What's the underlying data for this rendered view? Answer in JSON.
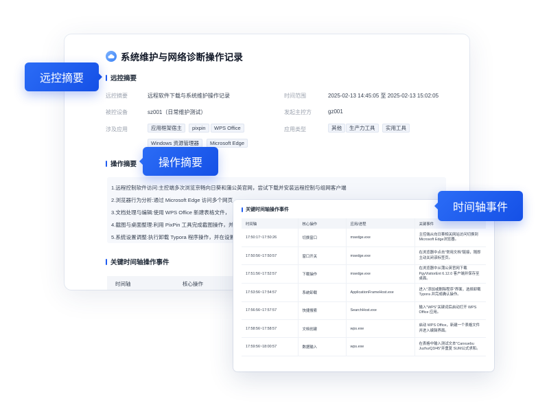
{
  "report": {
    "title": "系统维护与网络诊断操作记录",
    "remote_section": "远控摘要",
    "fields": {
      "summary_label": "远控摘要",
      "summary_value": "远程软件下载与系统维护操作记录",
      "time_label": "时间范围",
      "time_value": "2025-02-13 14:45:05 至 2025-02-13 15:02:05",
      "device_label": "被控设备",
      "device_value": "sz001（日常维护测试）",
      "initiator_label": "发起主控方",
      "initiator_value": "gz001",
      "apps_label": "涉及应用",
      "app_type_label": "应用类型"
    },
    "apps": [
      "应用框架宿主",
      "pixpin",
      "WPS Office",
      "Windows 资源管理器",
      "Microsoft Edge"
    ],
    "app_types": [
      "其他",
      "生产力工具",
      "实用工具"
    ],
    "ops_section": "操作摘要",
    "ops": [
      "1.远程控制软件访问:主控端多次浏览京畅向日葵和蒲公英官网，尝试下载并安装远程控制与组网客户端",
      "2.浏览器行为分析:通过 Microsoft Edge 访问多个网页",
      "3.文档处理与编辑:使用 WPS Office 新建表格文件，",
      "4.截图与桌面整理:利用 PixPin 工具完成截图操作，并",
      "5.系统设置调整:执行卸载 Typora 程序操作，并在设置"
    ],
    "timeline_section": "关键时间轴操作事件",
    "mini_headers": [
      "时间轴",
      "核心操作"
    ]
  },
  "callouts": {
    "remote": "远控摘要",
    "ops": "操作摘要",
    "timeline": "时间轴事件"
  },
  "timeline_panel": {
    "title": "关键时间轴操作事件",
    "headers": [
      "时间轴",
      "核心操作",
      "应用/进程",
      "关键事件"
    ],
    "rows": [
      {
        "time": "17:50:17~17:50:26",
        "op": "切换窗口",
        "proc": "msedge.exe",
        "desc": "主控端从向日葵相关网站访问切换到 Microsoft Edge浏览器。"
      },
      {
        "time": "17:50:56~17:50:57",
        "op": "窗口开关",
        "proc": "msedge.exe",
        "desc": "在浏览器中点击\"常用文档\"链接，随即主动关闭该标签页。"
      },
      {
        "time": "17:51:56~17:52:57",
        "op": "下载操作",
        "proc": "msedge.exe",
        "desc": "在浏览器中从蒲公英官网下载 PgyVisitorEnt 6.12.0 客户端并保存至桌面。"
      },
      {
        "time": "17:53:56~17:54:57",
        "op": "系统卸载",
        "proc": "ApplicationFrameHost.exe",
        "desc": "进入\"添加或删除程序\"界面，选择卸载 Typora 并完成确认操作。"
      },
      {
        "time": "17:56:56~17:57:57",
        "op": "快捷搜索",
        "proc": "SearchHost.exe",
        "desc": "输入\"WPS\"关键词后启动打开 WPS Office 应用。"
      },
      {
        "time": "17:58:56~17:58:57",
        "op": "文档创建",
        "proc": "wps.exe",
        "desc": "启动 WPS Office，新建一个表格文件并进入编辑界面。"
      },
      {
        "time": "17:59:56~18:00:57",
        "op": "数据输入",
        "proc": "wps.exe",
        "desc": "在表格中输入测试文本\"Canxuebu Juzhu/Q3/45\"并重复 SUM公式求和。"
      }
    ]
  }
}
